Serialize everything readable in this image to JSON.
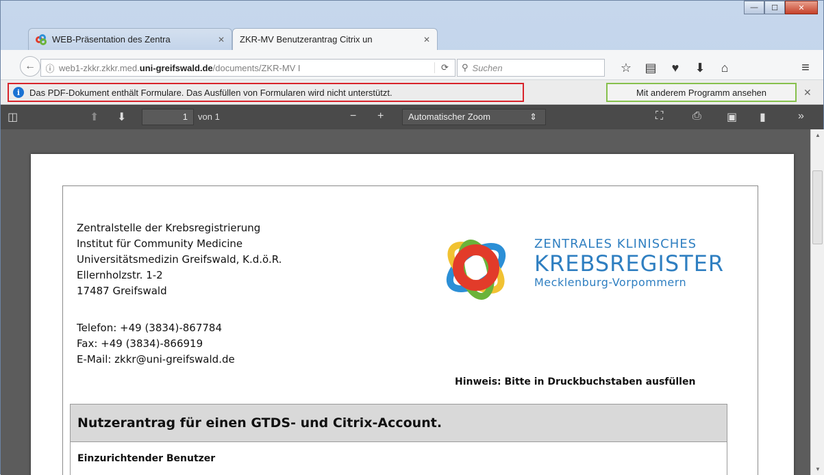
{
  "window": {
    "minimize": "—",
    "maximize": "☐",
    "close": "✕"
  },
  "tabs": [
    {
      "label": "WEB-Präsentation des Zentra",
      "close": "✕"
    },
    {
      "label": "ZKR-MV Benutzerantrag Citrix un",
      "close": "✕"
    }
  ],
  "new_tab": "+",
  "navbar": {
    "url_prefix": "web1-zkkr.zkkr.med.",
    "url_domain": "uni-greifswald.de",
    "url_suffix": "/documents/ZKR-MV I",
    "search_placeholder": "Suchen",
    "menu_icon": "≡"
  },
  "notification": {
    "message": "Das PDF-Dokument enthält Formulare. Das Ausfüllen von Formularen wird nicht unterstützt.",
    "button": "Mit anderem Programm ansehen",
    "close": "✕"
  },
  "pdf_toolbar": {
    "page_number": "1",
    "page_of": "von 1",
    "zoom": "Automatischer Zoom",
    "more": "»"
  },
  "document": {
    "address_lines": [
      "Zentralstelle der Krebsregistrierung",
      "Institut für Community Medicine",
      "Universitätsmedizin Greifswald, K.d.ö.R.",
      "Ellernholzstr. 1-2",
      "17487 Greifswald"
    ],
    "contact_lines": [
      "Telefon: +49 (3834)-867784",
      "Fax: +49 (3834)-866919",
      "E-Mail:  zkkr@uni-greifswald.de"
    ],
    "logo_line1": "ZENTRALES KLINISCHES",
    "logo_line2": "KREBSREGISTER",
    "logo_line3": "Mecklenburg-Vorpommern",
    "hint": "Hinweis: Bitte in Druckbuchstaben ausfüllen",
    "section_title": "Nutzerantrag für einen GTDS- und Citrix-Account.",
    "subsection": "Einzurichtender Benutzer"
  },
  "colors": {
    "highlight_red": "#d8232a",
    "highlight_green": "#86c04c",
    "logo_blue": "#2f7fc1",
    "pdf_toolbar": "#4a4a4a"
  }
}
